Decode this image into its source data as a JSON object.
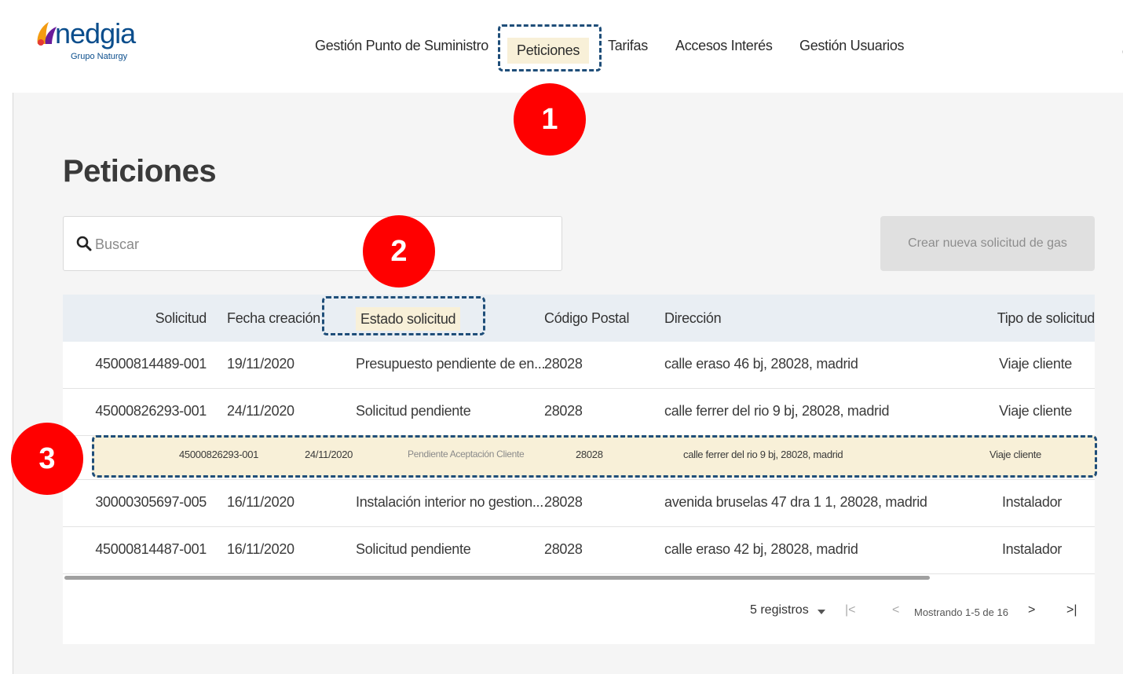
{
  "brand": {
    "name": "nedgia",
    "tagline": "Grupo Naturgy"
  },
  "nav": [
    {
      "label": "Gestión Punto de Suministro"
    },
    {
      "label": "Peticiones"
    },
    {
      "label": "Tarifas"
    },
    {
      "label": "Accesos Interés"
    },
    {
      "label": "Gestión Usuarios"
    }
  ],
  "badges": [
    "1",
    "2",
    "3"
  ],
  "page_title": "Peticiones",
  "search": {
    "placeholder": "Buscar"
  },
  "create_button": "Crear nueva solicitud de gas",
  "table": {
    "columns": [
      "Solicitud",
      "Fecha creación",
      "Estado solicitud",
      "Código Postal",
      "Dirección",
      "Tipo de solicitud"
    ],
    "rows": [
      [
        "45000814489-001",
        "19/11/2020",
        "Presupuesto pendiente de en...",
        "28028",
        "calle eraso 46 bj, 28028, madrid",
        "Viaje cliente"
      ],
      [
        "45000826293-001",
        "24/11/2020",
        "Solicitud pendiente",
        "28028",
        "calle ferrer del rio 9 bj, 28028, madrid",
        "Viaje cliente"
      ],
      [
        "30000305697-005",
        "16/11/2020",
        "Instalación interior no gestion...",
        "28028",
        "avenida bruselas 47 dra 1 1, 28028, madrid",
        "Instalador"
      ],
      [
        "45000814487-001",
        "16/11/2020",
        "Solicitud pendiente",
        "28028",
        "calle eraso 42 bj, 28028, madrid",
        "Instalador"
      ]
    ],
    "highlighted_row": [
      "45000826293-001",
      "24/11/2020",
      "Pendiente Aceptación Cliente",
      "28028",
      "calle ferrer del rio 9 bj, 28028, madrid",
      "Viaje cliente"
    ]
  },
  "pagination": {
    "page_size": "5 registros",
    "first": "|<",
    "prev": "<",
    "status": "Mostrando 1-5 de 16",
    "next": ">",
    "last": ">|"
  },
  "colors": {
    "highlight_fill": "#f8f0d8",
    "dash_border": "#1f4e79",
    "badge": "#ff0000",
    "brand_blue": "#0a4d8c",
    "brand_orange": "#f39c12"
  }
}
